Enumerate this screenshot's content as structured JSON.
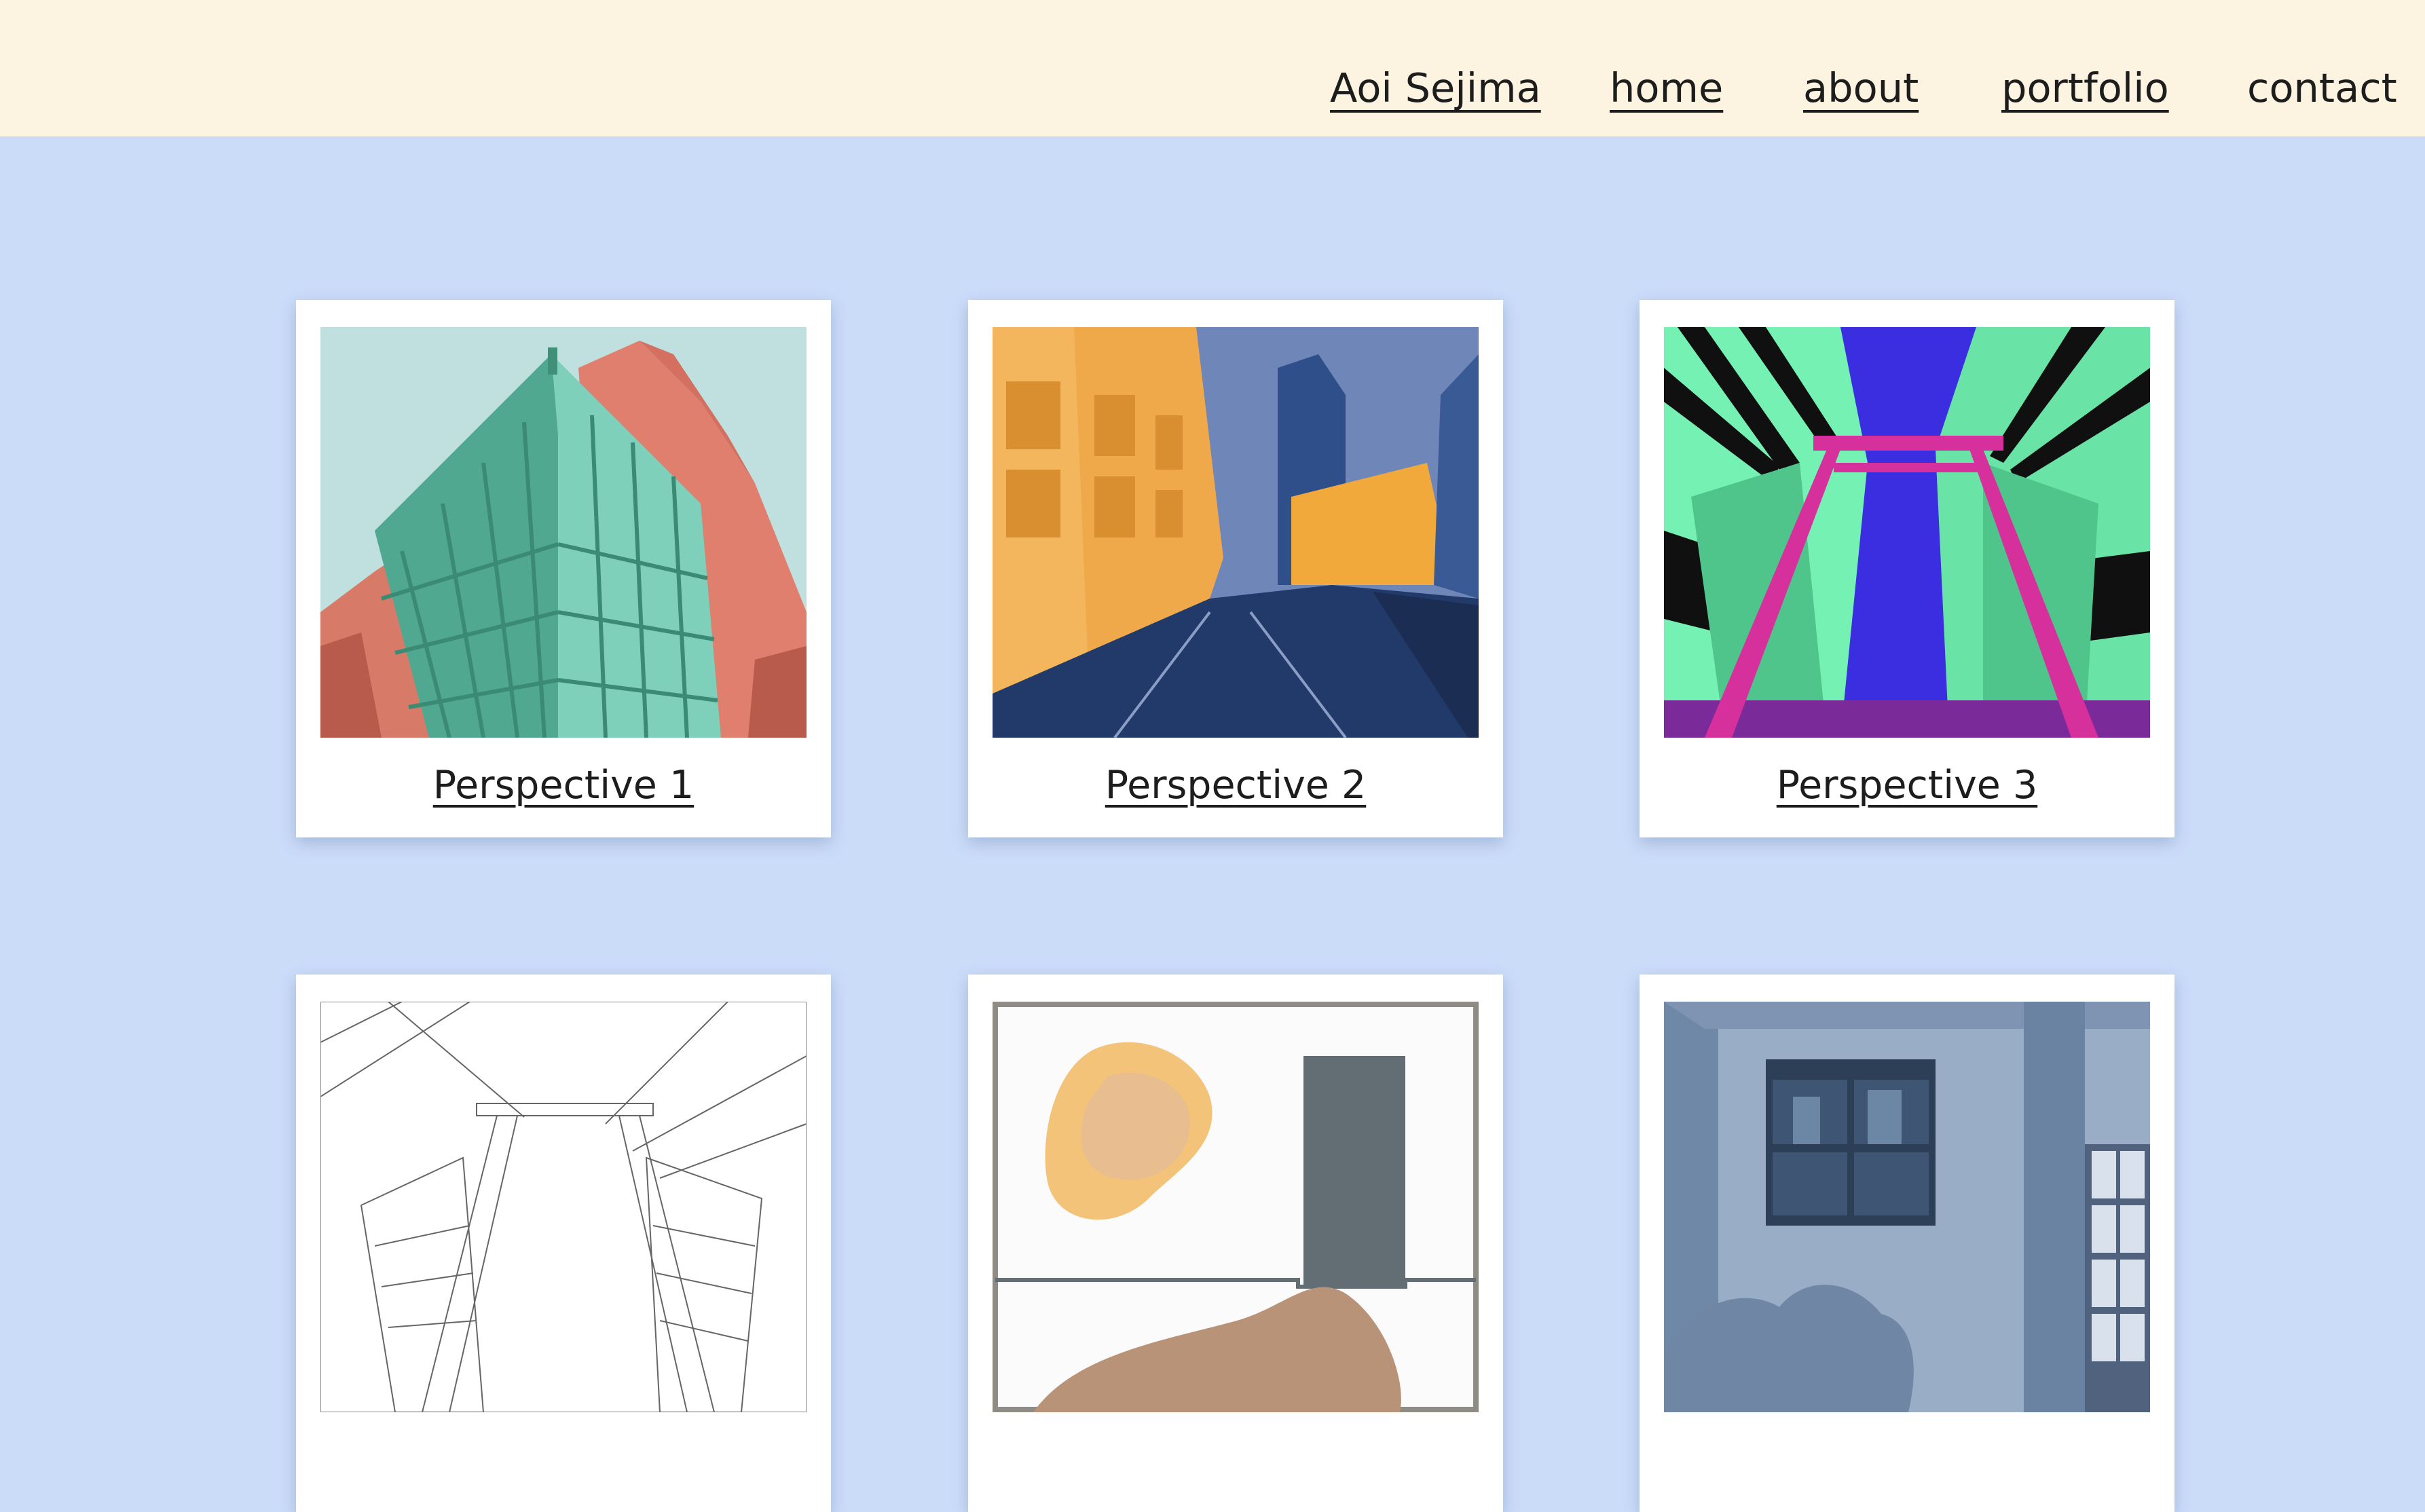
{
  "nav": {
    "brand": "Aoi Sejima",
    "home": "home",
    "about": "about",
    "portfolio": "portfolio",
    "contact": "contact"
  },
  "gallery": {
    "items": [
      {
        "caption": "Perspective 1"
      },
      {
        "caption": "Perspective 2"
      },
      {
        "caption": "Perspective 3"
      },
      {
        "caption": ""
      },
      {
        "caption": ""
      },
      {
        "caption": ""
      }
    ]
  },
  "colors": {
    "page_background": "#cbdcf9",
    "header_background": "#fdf3e1",
    "card_background": "#ffffff",
    "text": "#1d1d1d"
  }
}
